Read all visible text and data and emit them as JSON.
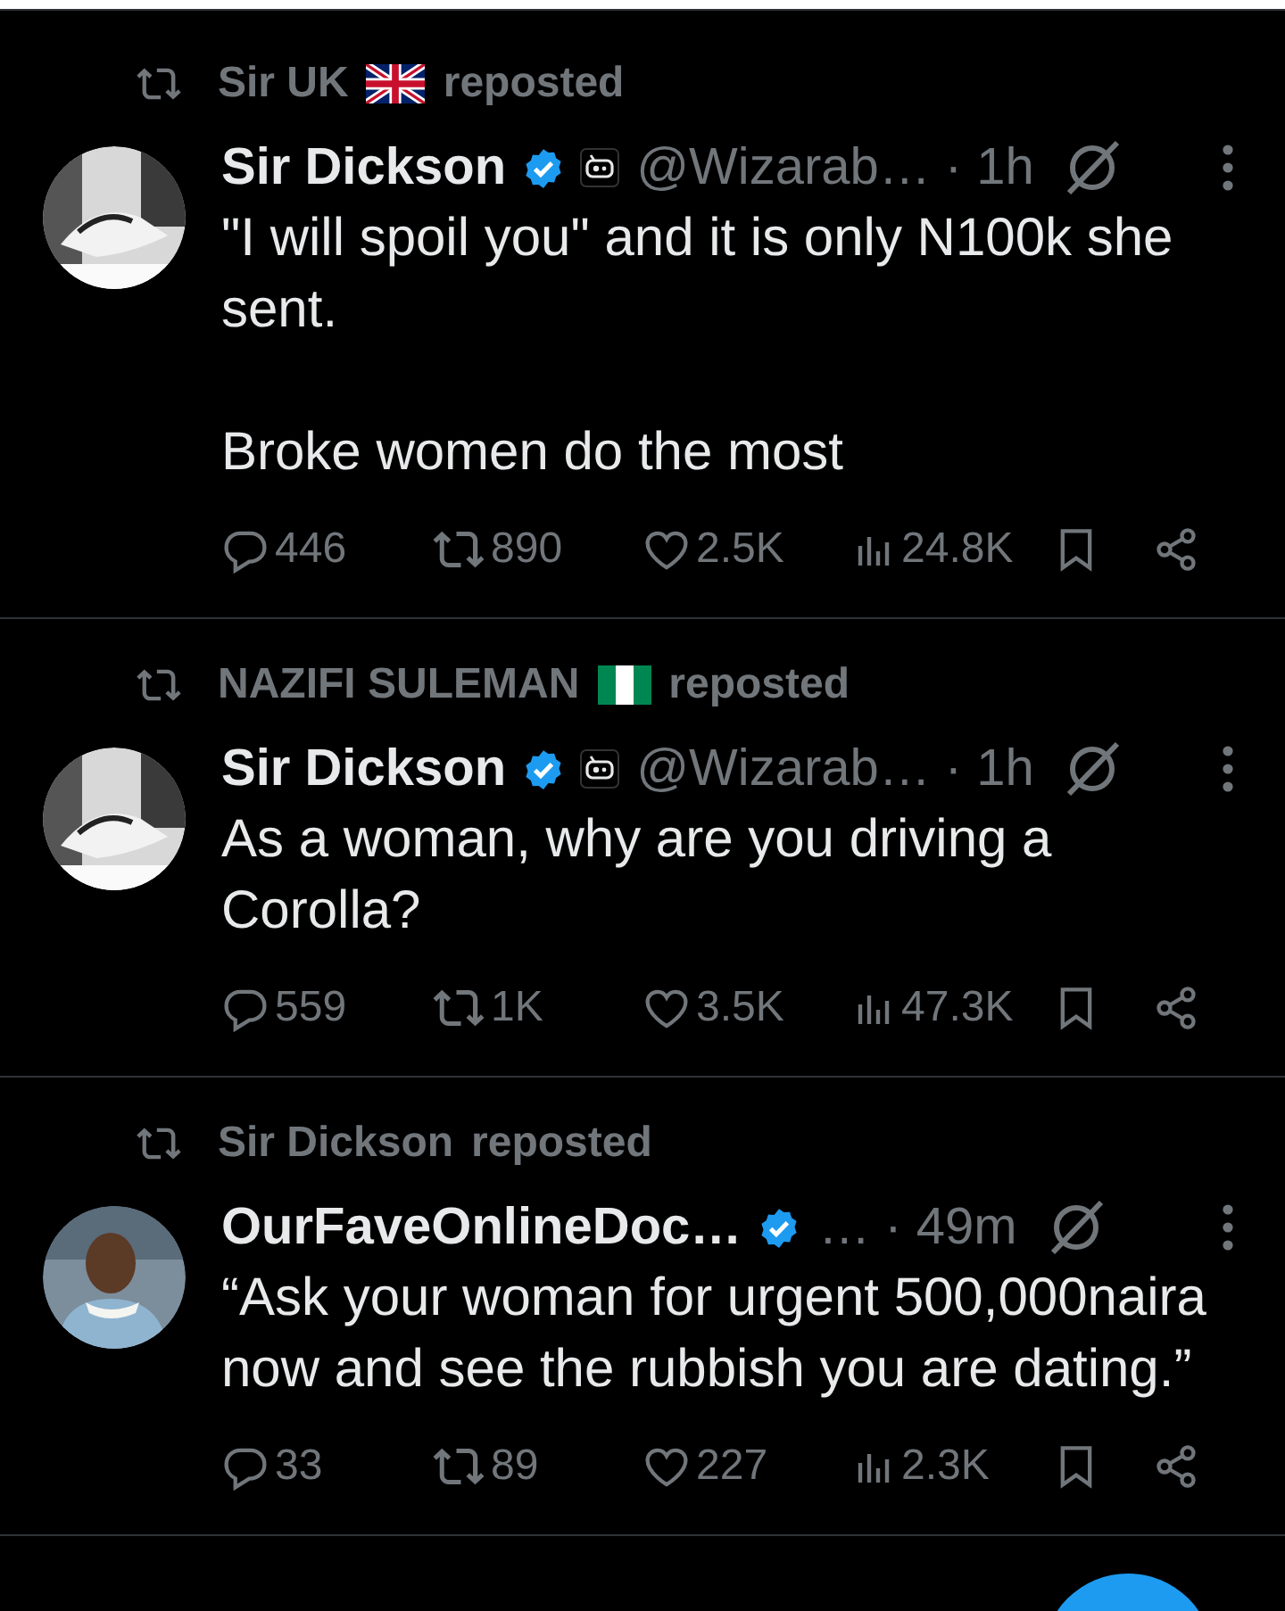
{
  "posts": [
    {
      "repost": {
        "by": "Sir UK",
        "flag": {
          "kind": "uk"
        },
        "label": "reposted"
      },
      "avatar": {
        "kind": "picture"
      },
      "name": "Sir Dickson",
      "verified": true,
      "bot_badge": true,
      "handle": "@Wizarab…",
      "time": "· 1h",
      "paragraphs": [
        "\"I will spoil you\" and it is only N100k she sent.",
        "Broke women do the most"
      ],
      "stats": {
        "replies": "446",
        "reposts": "890",
        "likes": "2.5K",
        "views": "24.8K"
      }
    },
    {
      "repost": {
        "by": "NAZIFI SULEMAN",
        "flag": {
          "kind": "ng"
        },
        "label": "reposted"
      },
      "avatar": {
        "kind": "picture"
      },
      "name": "Sir Dickson",
      "verified": true,
      "bot_badge": true,
      "handle": "@Wizarab…",
      "time": "· 1h",
      "paragraphs": [
        "As a woman, why are you driving a Corolla?"
      ],
      "stats": {
        "replies": "559",
        "reposts": "1K",
        "likes": "3.5K",
        "views": "47.3K"
      }
    },
    {
      "repost": {
        "by": "Sir Dickson",
        "label": "reposted"
      },
      "avatar": {
        "kind": "picture"
      },
      "name": "OurFaveOnlineDoc…",
      "verified": true,
      "bot_badge": false,
      "handle": "…",
      "time": "· 49m",
      "paragraphs": [
        "“Ask your woman for urgent 500,000naira now and see the rubbish you are dating.”"
      ],
      "stats": {
        "replies": "33",
        "reposts": "89",
        "likes": "227",
        "views": "2.3K"
      }
    }
  ]
}
